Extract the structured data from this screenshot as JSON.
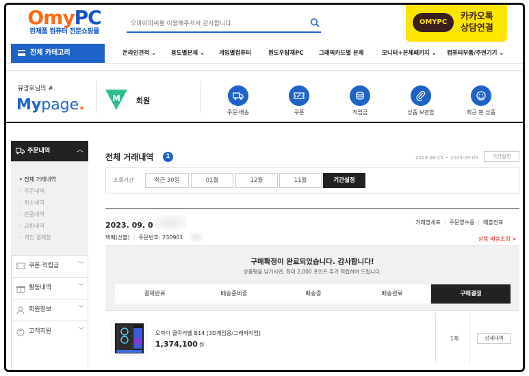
{
  "header": {
    "logo_main": "Omy",
    "logo_pc": "PC",
    "logo_tagline": "완제품 컴퓨터 전문쇼핑몰",
    "search_placeholder": "오마이피씨를 이용해주셔서 감사합니다.",
    "kakao_badge": "OMYPC",
    "kakao_line1": "카카오톡",
    "kakao_line2": "상담연결"
  },
  "nav": {
    "all_category": "전체 카테고리",
    "items": [
      "온라인견적",
      "용도별본체",
      "게임별컴퓨터",
      "윈도우탑재PC",
      "그래픽카드별 본체",
      "모니터+본체패키지",
      "컴퓨터부품/주변기기"
    ]
  },
  "mypage": {
    "greeting": "유광호님의 #",
    "title_my": "My",
    "title_page": "page",
    "title_dot": ".",
    "grade_letter": "M",
    "grade_label": "회원",
    "quick": [
      "주문·배송",
      "쿠폰",
      "적립금",
      "상품 보관함",
      "최근 본 상품"
    ]
  },
  "sidebar": {
    "order_section": "주문내역",
    "order_items": [
      "전체 거래내역",
      "주문내역",
      "취소내역",
      "반품내역",
      "교환내역",
      "개인 결제창"
    ],
    "sections": [
      "쿠폰·적립금",
      "활동내역",
      "회원정보",
      "고객지원"
    ]
  },
  "content": {
    "title": "전체 거래내역",
    "count": "1",
    "date_range": "2023-08-25 ~ 2023-09-05",
    "period_button": "기간설정",
    "filter_label": "조회기간",
    "filters": [
      "최근 30일",
      "01월",
      "12월",
      "11월",
      "기간설정"
    ],
    "order": {
      "date": "2023. 09. 01",
      "docs": [
        "거래명세표",
        "주문영수증",
        "매출전표"
      ],
      "ship_type": "택배(선불)",
      "order_no_label": "주문번호:",
      "order_no": "230901",
      "track_link": "상품 배송조회 >",
      "status_msg": "구매확정이 완료되었습니다. 감사합니다!",
      "status_sub": "상품평을 남기시면, 최대 2,000 포인트 추가 적립하여 드립니다.",
      "steps": [
        "결제완료",
        "배송준비중",
        "배송중",
        "배송완료",
        "구매결정"
      ],
      "active_step": 4,
      "product_name": "오마이 클락라벨 B14 [3D게임용/그래픽작업]",
      "price": "1,374,100",
      "price_unit": "원",
      "qty": "1개",
      "detail_button": "상세내역"
    }
  },
  "colors": {
    "brand_blue": "#1f63c9",
    "logo_orange": "#ff6a13",
    "kakao_yellow": "#fee500",
    "dark": "#222222",
    "link_red": "#e5251e"
  }
}
